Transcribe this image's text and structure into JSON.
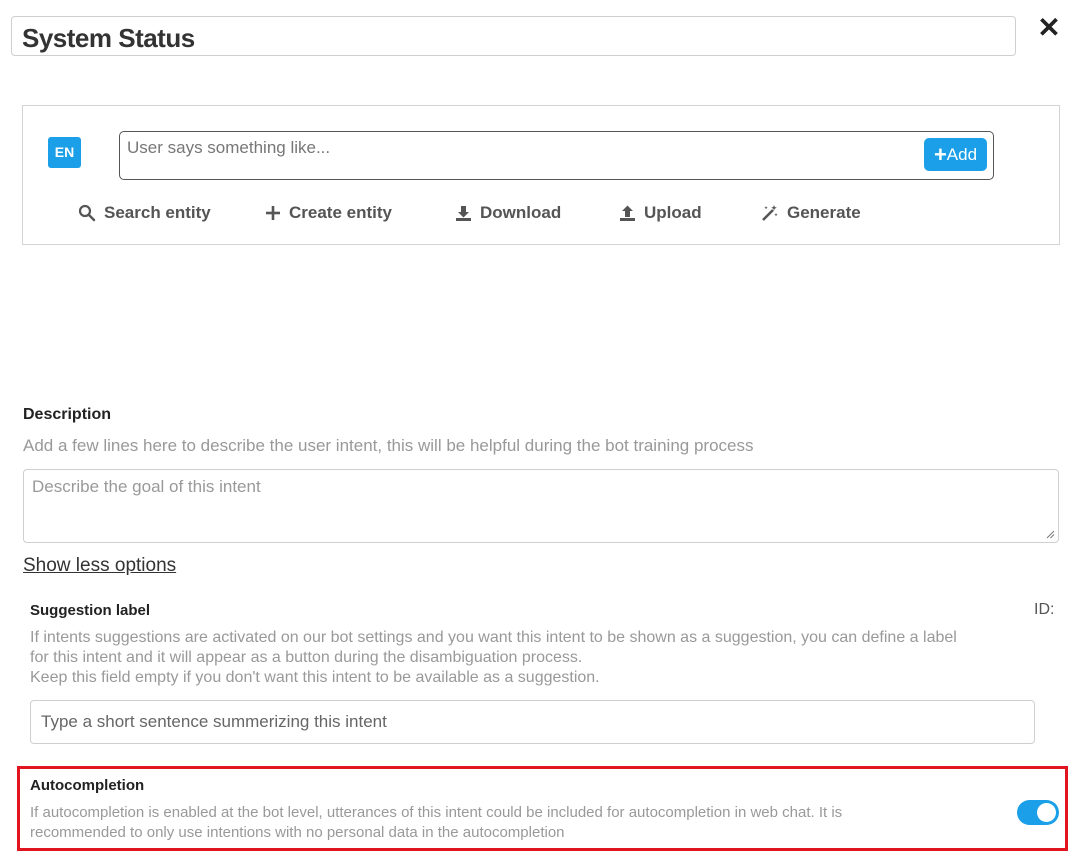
{
  "header": {
    "title": "System Status",
    "close_glyph": "✕"
  },
  "utterance": {
    "language": "EN",
    "placeholder": "User says something like...",
    "add_label": "Add"
  },
  "tools": [
    {
      "label": "Search entity",
      "icon": "search-icon"
    },
    {
      "label": "Create entity",
      "icon": "plus-icon"
    },
    {
      "label": "Download",
      "icon": "download-icon"
    },
    {
      "label": "Upload",
      "icon": "upload-icon"
    },
    {
      "label": "Generate",
      "icon": "magic-wand-icon"
    }
  ],
  "description": {
    "label": "Description",
    "hint": "Add a few lines here to describe the user intent, this will be helpful during the bot training process",
    "placeholder": "Describe the goal of this intent"
  },
  "options_link": "Show less options",
  "suggestion": {
    "label": "Suggestion label",
    "id_label": "ID:",
    "hint_line1": "If intents suggestions are activated on our bot settings and you want this intent to be shown as a suggestion, you can define a label",
    "hint_line2": "for this intent and it will appear as a button during the disambiguation process.",
    "hint_line3": "Keep this field empty if you don't want this intent to be available as a suggestion.",
    "placeholder": "Type a short sentence summerizing this intent"
  },
  "autocompletion": {
    "label": "Autocompletion",
    "hint_line1": "If autocompletion is enabled at the bot level, utterances of this intent could be included for autocompletion in web chat. It is",
    "hint_line2": "recommended to only use intentions with no personal data in the autocompletion",
    "enabled": true
  },
  "colors": {
    "accent": "#1a9fe8",
    "highlight": "#e1151f"
  }
}
